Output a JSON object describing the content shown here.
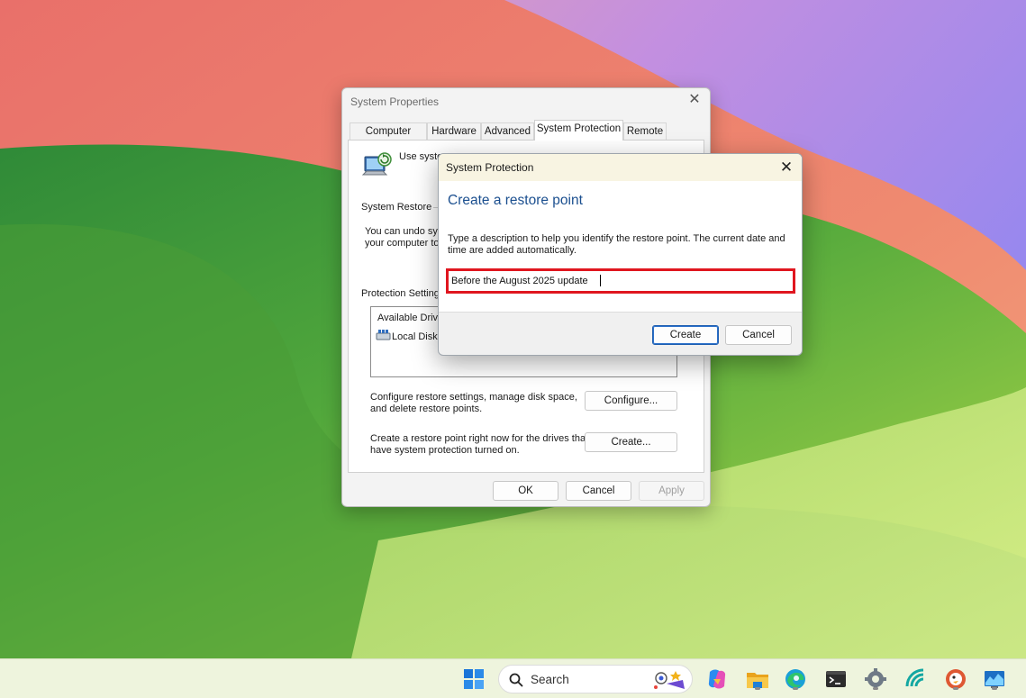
{
  "system_properties": {
    "title": "System Properties",
    "tabs": [
      "Computer Name",
      "Hardware",
      "Advanced",
      "System Protection",
      "Remote"
    ],
    "active_tab": "System Protection",
    "intro_text": "Use syste",
    "system_restore_label": "System Restore",
    "system_restore_text_1": "You can undo sys",
    "system_restore_text_2": "your computer to",
    "protection_settings_label": "Protection Settings",
    "drives_header": "Available Drive",
    "drive_item": "Local Disk",
    "configure_text_1": "Configure restore settings, manage disk space,",
    "configure_text_2": "and delete restore points.",
    "configure_button": "Configure...",
    "create_text_1": "Create a restore point right now for the drives that",
    "create_text_2": "have system protection turned on.",
    "create_button": "Create...",
    "ok_button": "OK",
    "cancel_button": "Cancel",
    "apply_button": "Apply"
  },
  "system_protection_dialog": {
    "title": "System Protection",
    "heading": "Create a restore point",
    "description_line_1": "Type a description to help you identify the restore point. The current date and",
    "description_line_2": "time are added automatically.",
    "input_value": "Before the August 2025 update",
    "create_button": "Create",
    "cancel_button": "Cancel",
    "highlight_color": "#e0161f"
  },
  "taskbar": {
    "search_label": "Search",
    "icons": [
      "start-icon",
      "copilot-icon",
      "file-explorer-icon",
      "edge-icon",
      "terminal-icon",
      "settings-icon",
      "wifi-analyzer-icon",
      "duckduckgo-icon",
      "resource-monitor-icon"
    ]
  },
  "colors": {
    "accent": "#1b4f8f",
    "highlight": "#e0161f",
    "taskbar_bg": "#eef4dd"
  }
}
